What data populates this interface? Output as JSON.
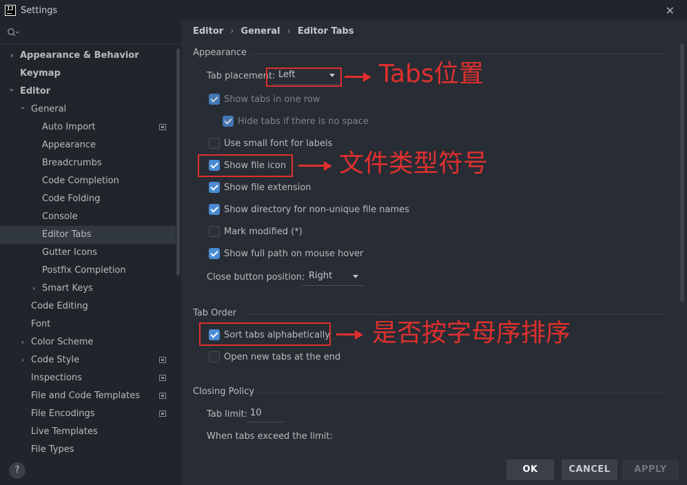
{
  "window": {
    "title": "Settings",
    "logo_text": "IJ"
  },
  "search": {
    "icon": "search-icon"
  },
  "sidebar": {
    "items": [
      {
        "label": "Appearance & Behavior",
        "chevron": "›",
        "bold": true
      },
      {
        "label": "Keymap",
        "bold": true
      },
      {
        "label": "Editor",
        "chevron": "⌄",
        "bold": true
      },
      {
        "label": "General",
        "chevron": "⌄"
      },
      {
        "label": "Auto Import",
        "badge": true
      },
      {
        "label": "Appearance"
      },
      {
        "label": "Breadcrumbs"
      },
      {
        "label": "Code Completion"
      },
      {
        "label": "Code Folding"
      },
      {
        "label": "Console"
      },
      {
        "label": "Editor Tabs",
        "selected": true
      },
      {
        "label": "Gutter Icons"
      },
      {
        "label": "Postfix Completion"
      },
      {
        "label": "Smart Keys",
        "chevron": "›"
      },
      {
        "label": "Code Editing"
      },
      {
        "label": "Font"
      },
      {
        "label": "Color Scheme",
        "chevron": "›"
      },
      {
        "label": "Code Style",
        "chevron": "›",
        "badge": true
      },
      {
        "label": "Inspections",
        "badge": true
      },
      {
        "label": "File and Code Templates",
        "badge": true
      },
      {
        "label": "File Encodings",
        "badge": true
      },
      {
        "label": "Live Templates"
      },
      {
        "label": "File Types"
      }
    ],
    "help_label": "?"
  },
  "breadcrumb": {
    "parts": [
      "Editor",
      "General",
      "Editor Tabs"
    ],
    "separator": "›"
  },
  "appearance": {
    "title": "Appearance",
    "tab_placement_label": "Tab placement:",
    "tab_placement_value": "Left",
    "show_tabs_one_row": "Show tabs in one row",
    "hide_tabs_no_space": "Hide tabs if there is no space",
    "small_font": "Use small font for labels",
    "show_file_icon": "Show file icon",
    "show_file_extension": "Show file extension",
    "show_directory": "Show directory for non-unique file names",
    "mark_modified": "Mark modified (*)",
    "show_full_path": "Show full path on mouse hover",
    "close_button_label": "Close button position:",
    "close_button_value": "Right"
  },
  "tab_order": {
    "title": "Tab Order",
    "sort_alpha": "Sort tabs alphabetically",
    "open_at_end": "Open new tabs at the end"
  },
  "closing_policy": {
    "title": "Closing Policy",
    "tab_limit_label": "Tab limit:",
    "tab_limit_value": "10",
    "exceed_label": "When tabs exceed the limit:"
  },
  "annotations": {
    "tabs_position": "Tabs位置",
    "file_icon": "文件类型符号",
    "sort_order": "是否按字母序排序"
  },
  "buttons": {
    "ok": "OK",
    "cancel": "CANCEL",
    "apply": "APPLY"
  }
}
